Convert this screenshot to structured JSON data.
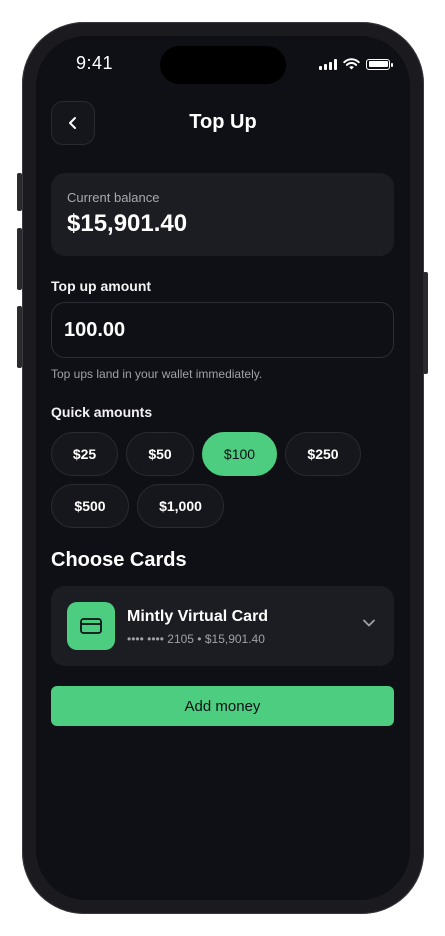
{
  "status_bar": {
    "time": "9:41"
  },
  "header": {
    "title": "Top Up"
  },
  "balance": {
    "label": "Current balance",
    "value": "$15,901.40"
  },
  "topup": {
    "label": "Top up amount",
    "value": "100.00",
    "hint": "Top ups land in your wallet immediately."
  },
  "quick_amounts": {
    "label": "Quick amounts",
    "options": [
      "$25",
      "$50",
      "$100",
      "$250",
      "$500",
      "$1,000"
    ],
    "selected": "$100"
  },
  "cards": {
    "title": "Choose Cards",
    "selected_card": {
      "name": "Mintly Virtual Card",
      "detail": "•••• •••• 2105 • $15,901.40"
    }
  },
  "actions": {
    "add_money_label": "Add money"
  },
  "colors": {
    "accent": "#4ccd7f",
    "background": "#0f1015",
    "surface": "#1c1d23"
  }
}
